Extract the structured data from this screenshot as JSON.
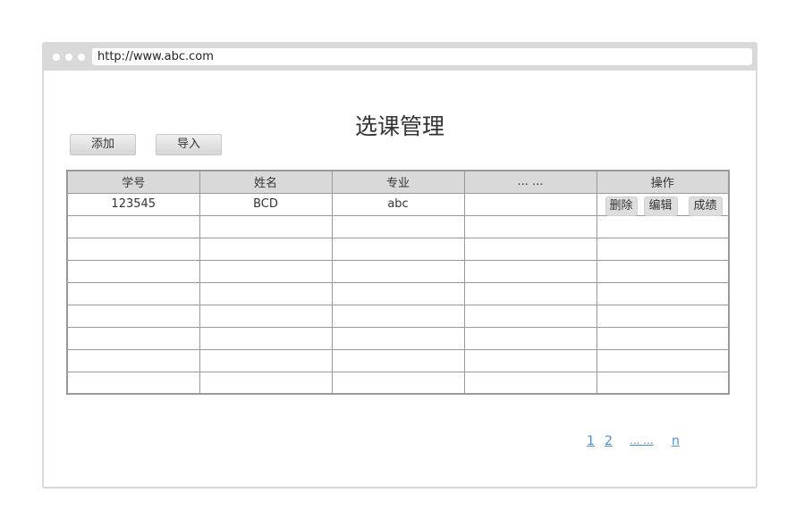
{
  "browser": {
    "url": "http://www.abc.com"
  },
  "page": {
    "title": "选课管理"
  },
  "toolbar": {
    "add_label": "添加",
    "import_label": "导入"
  },
  "table": {
    "headers": [
      "学号",
      "姓名",
      "专业",
      "... ...",
      "操作"
    ],
    "rows": [
      {
        "id": "123545",
        "name": "BCD",
        "major": "abc",
        "extra": ""
      }
    ],
    "actions": {
      "delete": "删除",
      "edit": "编辑",
      "grade": "成绩"
    }
  },
  "pagination": {
    "p1": "1",
    "p2": "2",
    "ellipsis": "... ...",
    "last": "n"
  },
  "colors": {
    "browser_frame": "#d9d9d9",
    "header_bg": "#d9d9d9",
    "link": "#4a90d9"
  }
}
